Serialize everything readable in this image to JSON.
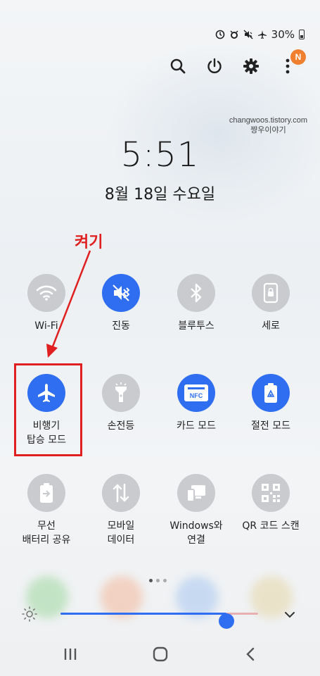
{
  "status_bar": {
    "icons": [
      "sync-icon",
      "alarm-icon",
      "mute-icon",
      "airplane-mode-icon"
    ],
    "battery_text": "30%"
  },
  "actions": {
    "search": "search-icon",
    "power": "power-icon",
    "settings": "gear-icon",
    "more": "more-vert-icon",
    "badge": "N"
  },
  "watermark": {
    "line1": "changwoos.tistory.com",
    "line2": "쨩우이야기"
  },
  "clock": {
    "time": "5:51",
    "date": "8월 18일 수요일"
  },
  "annotation": {
    "text": "켜기",
    "color": "#e02020"
  },
  "tiles": [
    {
      "label": "Wi-Fi",
      "state": "off",
      "icon": "wifi-icon"
    },
    {
      "label": "진동",
      "state": "on",
      "icon": "vibrate-icon"
    },
    {
      "label": "블루투스",
      "state": "off",
      "icon": "bluetooth-icon"
    },
    {
      "label": "세로",
      "state": "off",
      "icon": "portrait-lock-icon"
    },
    {
      "label": "비행기\n탑승 모드",
      "state": "on",
      "icon": "airplane-icon"
    },
    {
      "label": "손전등",
      "state": "off",
      "icon": "flashlight-icon"
    },
    {
      "label": "카드 모드",
      "state": "on",
      "icon": "nfc-icon"
    },
    {
      "label": "절전 모드",
      "state": "on",
      "icon": "power-saving-icon"
    },
    {
      "label": "무선\n배터리 공유",
      "state": "off",
      "icon": "wireless-powershare-icon"
    },
    {
      "label": "모바일\n데이터",
      "state": "off",
      "icon": "mobile-data-icon"
    },
    {
      "label": "Windows와\n연결",
      "state": "off",
      "icon": "link-to-windows-icon"
    },
    {
      "label": "QR 코드 스캔",
      "state": "off",
      "icon": "qr-code-icon"
    }
  ],
  "nfc_text": "NFC",
  "pager": {
    "pages": 3,
    "current": 1
  },
  "brightness": {
    "level": 0.84
  },
  "colors": {
    "accent": "#2f6ef0",
    "off": "#c9cbce",
    "annotation": "#e02020"
  }
}
